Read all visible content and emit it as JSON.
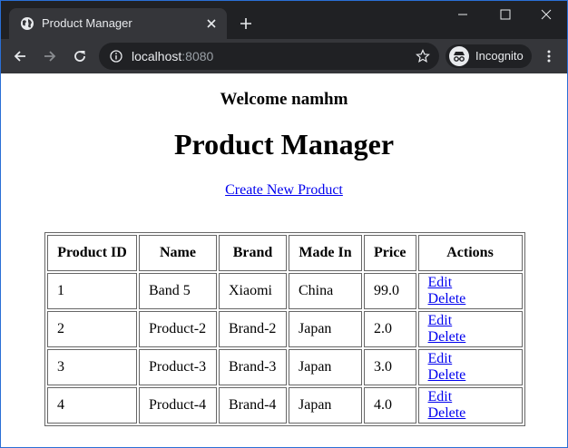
{
  "browser": {
    "tab_title": "Product Manager",
    "url_host": "localhost",
    "url_port": ":8080",
    "incognito_label": "Incognito"
  },
  "page": {
    "welcome": "Welcome namhm",
    "title": "Product Manager",
    "create_link": "Create New Product"
  },
  "table": {
    "headers": [
      "Product ID",
      "Name",
      "Brand",
      "Made In",
      "Price",
      "Actions"
    ],
    "rows": [
      {
        "id": "1",
        "name": "Band 5",
        "brand": "Xiaomi",
        "made_in": "China",
        "price": "99.0",
        "edit": "Edit",
        "delete": "Delete"
      },
      {
        "id": "2",
        "name": "Product-2",
        "brand": "Brand-2",
        "made_in": "Japan",
        "price": "2.0",
        "edit": "Edit",
        "delete": "Delete"
      },
      {
        "id": "3",
        "name": "Product-3",
        "brand": "Brand-3",
        "made_in": "Japan",
        "price": "3.0",
        "edit": "Edit",
        "delete": "Delete"
      },
      {
        "id": "4",
        "name": "Product-4",
        "brand": "Brand-4",
        "made_in": "Japan",
        "price": "4.0",
        "edit": "Edit",
        "delete": "Delete"
      }
    ]
  },
  "colors": {
    "link": "#0000ee",
    "chrome_dark": "#202124",
    "chrome_tab": "#35363a"
  }
}
